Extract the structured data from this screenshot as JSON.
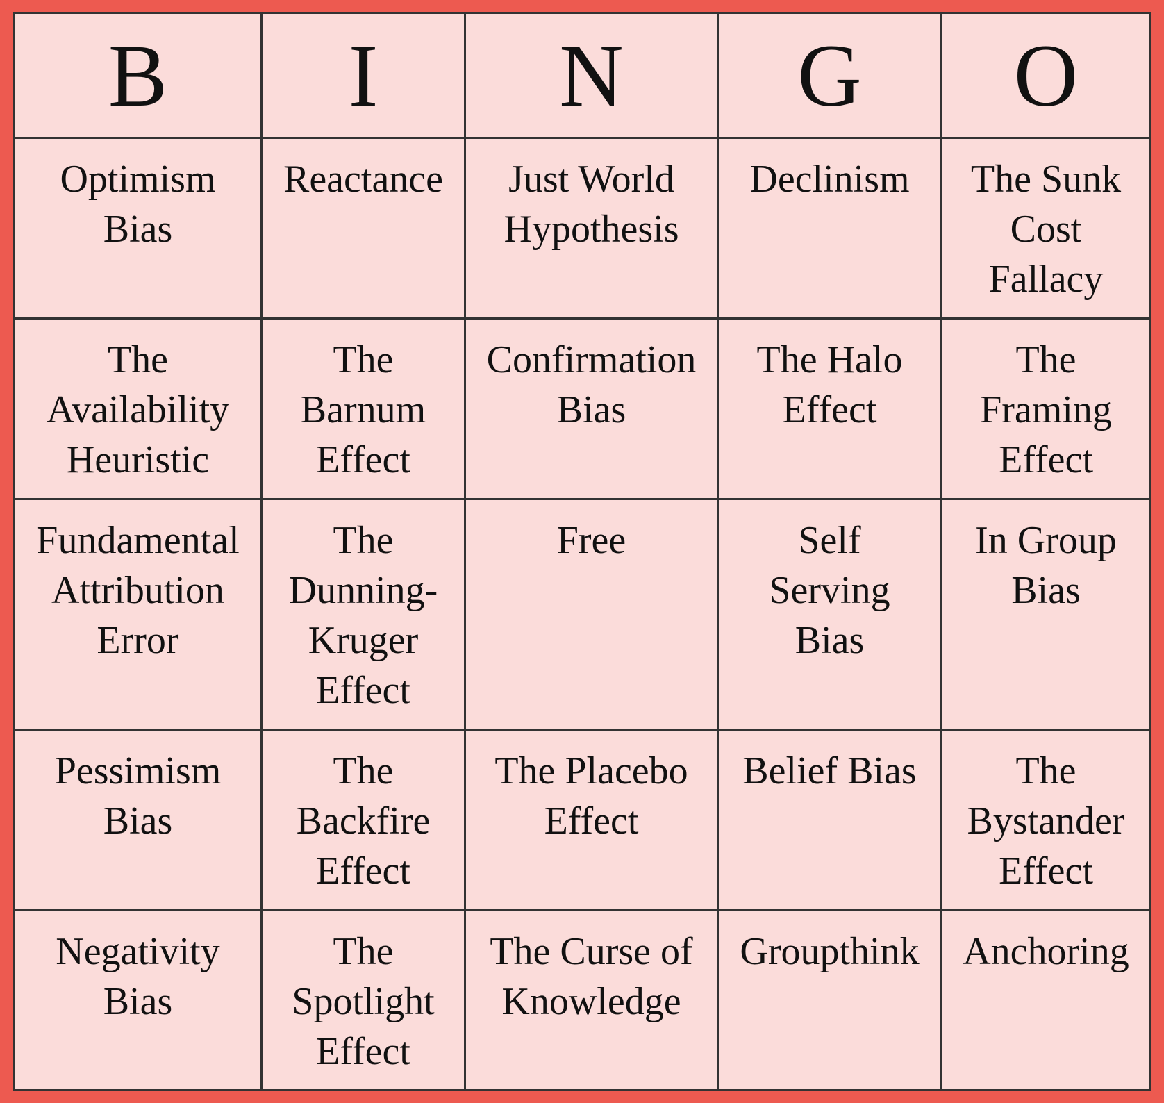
{
  "card": {
    "header": [
      "B",
      "I",
      "N",
      "G",
      "O"
    ],
    "rows": [
      [
        "Optimism\nBias",
        "Reactance",
        "Just World\nHypothesis",
        "Declinism",
        "The Sunk\nCost\nFallacy"
      ],
      [
        "The\nAvailability\nHeuristic",
        "The\nBarnum\nEffect",
        "Confirmation\nBias",
        "The Halo\nEffect",
        "The\nFraming\nEffect"
      ],
      [
        "Fundamental\nAttribution\nError",
        "The\nDunning-\nKruger\nEffect",
        "Free",
        "Self\nServing\nBias",
        "In Group\nBias"
      ],
      [
        "Pessimism\nBias",
        "The\nBackfire\nEffect",
        "The Placebo\nEffect",
        "Belief Bias",
        "The\nBystander\nEffect"
      ],
      [
        "Negativity\nBias",
        "The\nSpotlight\nEffect",
        "The Curse of\nKnowledge",
        "Groupthink",
        "Anchoring"
      ]
    ]
  },
  "colors": {
    "frame": "#ed5a50",
    "cell_fill": "#fbdcda",
    "grid_line": "#333333",
    "text": "#111111"
  }
}
